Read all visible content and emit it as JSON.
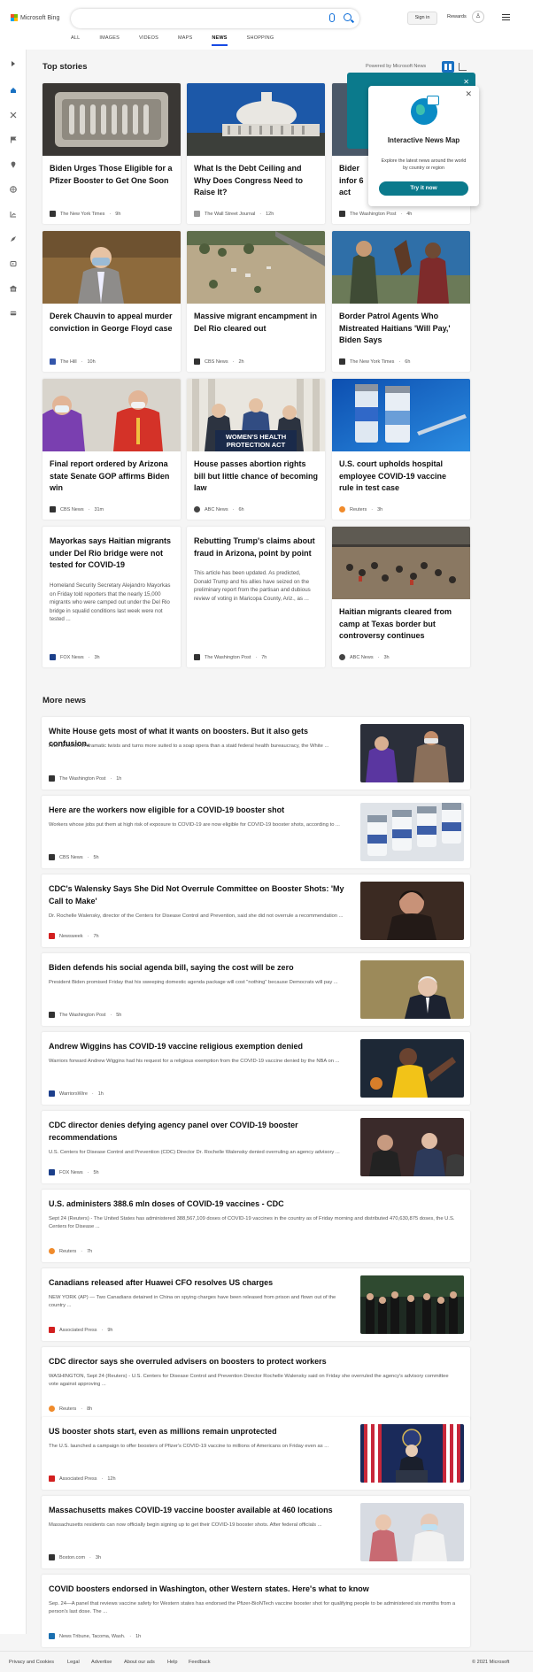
{
  "header": {
    "brand": "Microsoft Bing",
    "signin_label": "Sign in",
    "rewards_label": "Rewards",
    "tabs": [
      {
        "label": "ALL"
      },
      {
        "label": "IMAGES"
      },
      {
        "label": "VIDEOS"
      },
      {
        "label": "MAPS"
      },
      {
        "label": "NEWS",
        "active": true
      },
      {
        "label": "SHOPPING"
      }
    ]
  },
  "top_stories": {
    "title": "Top stories",
    "powered_by": "Powered by Microsoft News",
    "cards": [
      {
        "title": "Biden Urges Those Eligible for a Pfizer Booster to Get One Soon",
        "source": "The New York Times",
        "time": "9h"
      },
      {
        "title": "What Is the Debt Ceiling and Why Does Congress Need to Raise It?",
        "source": "The Wall Street Journal",
        "time": "12h"
      },
      {
        "title": "Bider infor 6 act",
        "source": "The Washington Post",
        "time": "4h"
      },
      {
        "title": "Derek Chauvin to appeal murder conviction in George Floyd case",
        "source": "The Hill",
        "time": "10h"
      },
      {
        "title": "Massive migrant encampment in Del Rio cleared out",
        "source": "CBS News",
        "time": "2h"
      },
      {
        "title": "Border Patrol Agents Who Mistreated Haitians 'Will Pay,' Biden Says",
        "source": "The New York Times",
        "time": "6h"
      },
      {
        "title": "Final report ordered by Arizona state Senate GOP affirms Biden win",
        "source": "CBS News",
        "time": "31m"
      },
      {
        "title": "House passes abortion rights bill but little chance of becoming law",
        "source": "ABC News",
        "time": "6h",
        "banner": "WOMEN'S HEALTH PROTECTION ACT"
      },
      {
        "title": "U.S. court upholds hospital employee COVID-19 vaccine rule in test case",
        "source": "Reuters",
        "time": "3h"
      },
      {
        "title": "Mayorkas says Haitian migrants under Del Rio bridge were not tested for COVID-19",
        "desc": "Homeland Security Secretary Alejandro Mayorkas on Friday told reporters that the nearly 15,000 migrants who were camped out under the Del Rio bridge in squalid conditions last week were not tested ...",
        "source": "FOX News",
        "time": "3h"
      },
      {
        "title": "Rebutting Trump's claims about fraud in Arizona, point by point",
        "desc": "This article has been updated. As predicted, Donald Trump and his allies have seized on the preliminary report from the partisan and dubious review of voting in Maricopa County, Ariz., as ...",
        "source": "The Washington Post",
        "time": "7h"
      },
      {
        "title": "Haitian migrants cleared from camp at Texas border but controversy continues",
        "source": "ABC News",
        "time": "3h"
      }
    ]
  },
  "popup": {
    "title": "Interactive News Map",
    "desc": "Explore the latest news around the world by country or region",
    "button": "Try it now"
  },
  "more_news": {
    "title": "More news",
    "items": [
      {
        "title": "White House gets most of what it wants on boosters. But it also gets confusion.",
        "desc": "After a month of dramatic twists and turns more suited to a soap opera than a staid federal health bureaucracy, the White ...",
        "source": "The Washington Post",
        "time": "1h"
      },
      {
        "title": "Here are the workers now eligible for a COVID-19 booster shot",
        "desc": "Workers whose jobs put them at high risk of exposure to COVID-19 are now eligible for COVID-19 booster shots, according to ...",
        "source": "CBS News",
        "time": "5h"
      },
      {
        "title": "CDC's Walensky Says She Did Not Overrule Committee on Booster Shots: 'My Call to Make'",
        "desc": "Dr. Rochelle Walensky, director of the Centers for Disease Control and Prevention, said she did not overrule a recommendation ...",
        "source": "Newsweek",
        "time": "7h"
      },
      {
        "title": "Biden defends his social agenda bill, saying the cost will be zero",
        "desc": "President Biden promised Friday that his sweeping domestic agenda package will cost \"nothing\" because Democrats will pay ...",
        "source": "The Washington Post",
        "time": "5h"
      },
      {
        "title": "Andrew Wiggins has COVID-19 vaccine religious exemption denied",
        "desc": "Warriors forward Andrew Wiggins had his request for a religious exemption from the COVID-19 vaccine denied by the NBA on ...",
        "source": "WarriorsWire",
        "time": "1h"
      },
      {
        "title": "CDC director denies defying agency panel over COVID-19 booster recommendations",
        "desc": "U.S. Centers for Disease Control and Prevention (CDC) Director Dr. Rochelle Walensky denied overruling an agency advisory ...",
        "source": "FOX News",
        "time": "5h"
      },
      {
        "title": "U.S. administers 388.6 mln doses of COVID-19 vaccines - CDC",
        "desc": "Sept 24 (Reuters) - The United States has administered 388,567,109 doses of COVID-19 vaccines in the country as of Friday morning and distributed 470,630,875 doses, the U.S. Centers for Disease ...",
        "source": "Reuters",
        "time": "7h"
      },
      {
        "title": "Canadians released after Huawei CFO resolves US charges",
        "desc": "NEW YORK (AP) — Two Canadians detained in China on spying charges have been released from prison and flown out of the country ...",
        "source": "Associated Press",
        "time": "9h"
      },
      {
        "title": "CDC director says she overruled advisers on boosters to protect workers",
        "desc": "WASHINGTON, Sept 24 (Reuters) - U.S. Centers for Disease Control and Prevention Director Rochelle Walensky said on Friday she overruled the agency's advisory committee vote against approving ...",
        "source": "Reuters",
        "time": "8h"
      },
      {
        "title": "US booster shots start, even as millions remain unprotected",
        "desc": "The U.S. launched a campaign to offer boosters of Pfizer's COVID-19 vaccine to millions of Americans on Friday even as ...",
        "source": "Associated Press",
        "time": "12h"
      },
      {
        "title": "Massachusetts makes COVID-19 vaccine booster available at 460 locations",
        "desc": "Massachusetts residents can now officially begin signing up to get their COVID-19 booster shots. After federal officials ...",
        "source": "Boston.com",
        "time": "3h"
      },
      {
        "title": "COVID boosters endorsed in Washington, other Western states. Here's what to know",
        "desc": "Sep. 24—A panel that reviews vaccine safety for Western states has endorsed the Pfizer-BioNTech vaccine booster shot for qualifying people to be administered six months from a person's last dose. The ...",
        "source": "News Tribune, Tacoma, Wash.",
        "time": "1h"
      }
    ]
  },
  "footer": {
    "links": [
      "Privacy and Cookies",
      "Legal",
      "Advertise",
      "About our ads",
      "Help",
      "Feedback"
    ],
    "copyright": "© 2021 Microsoft"
  }
}
